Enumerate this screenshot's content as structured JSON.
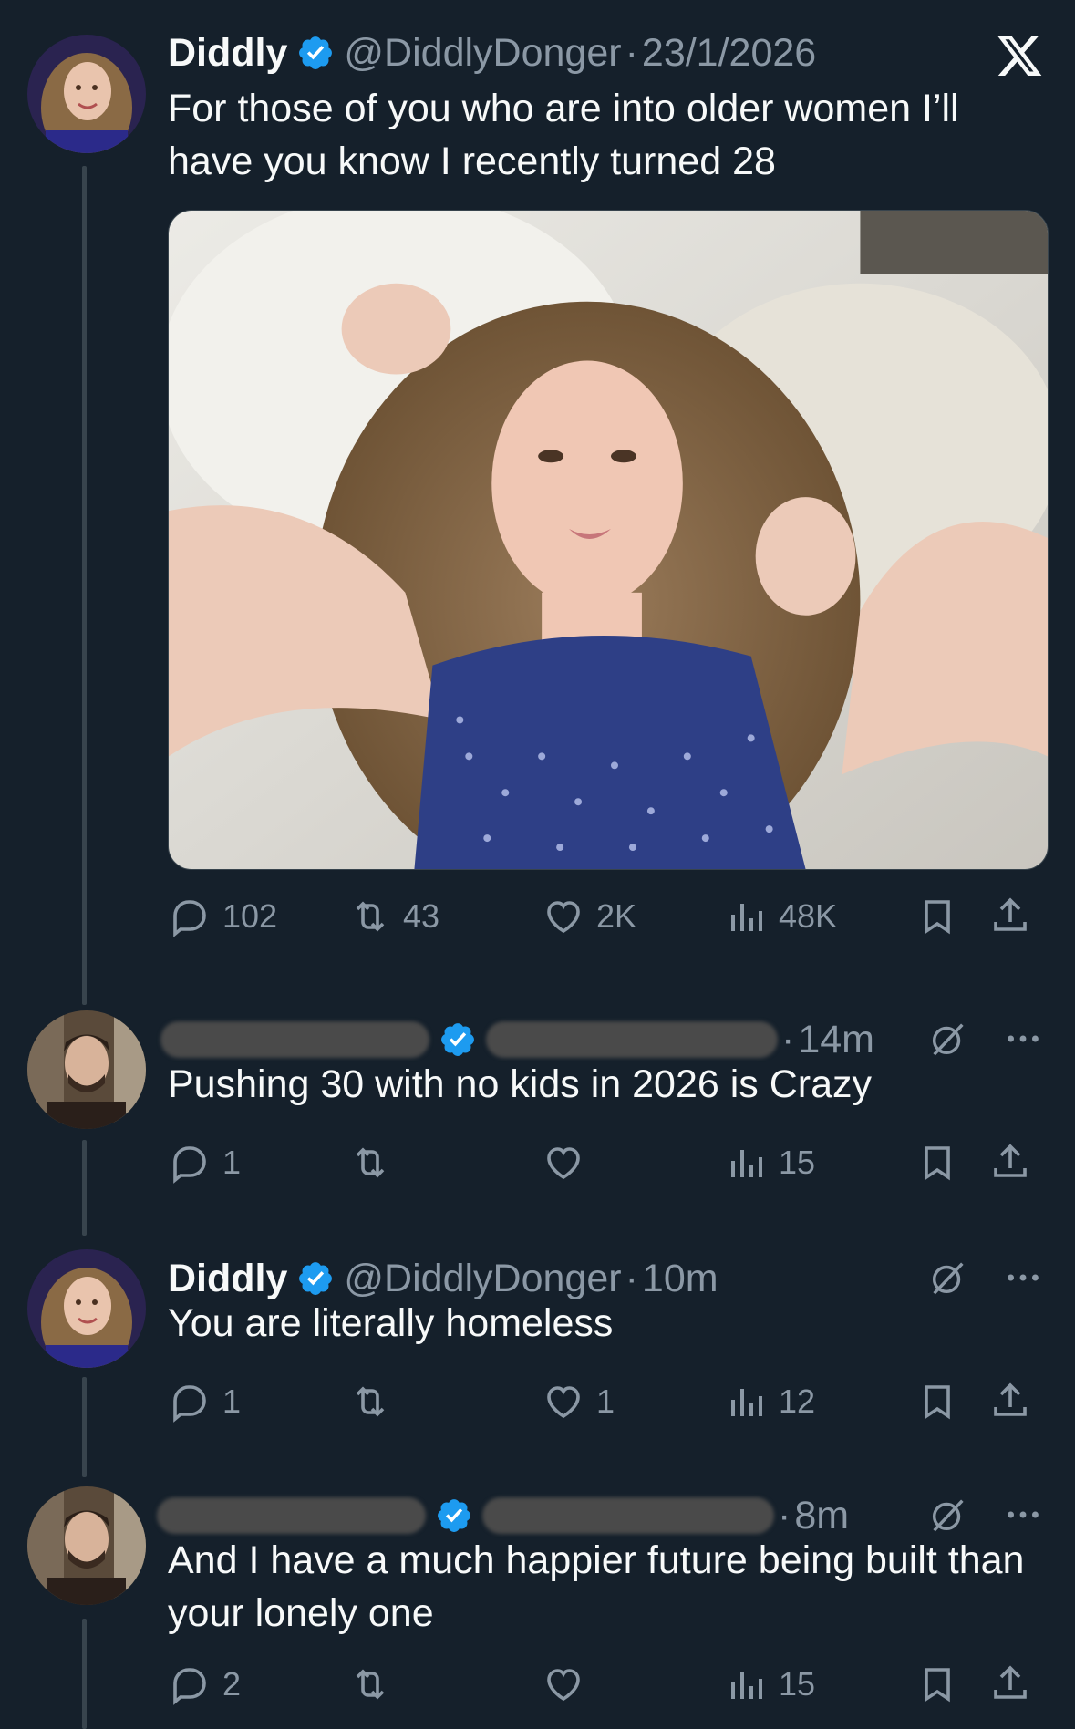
{
  "theme": {
    "background": "#15202b",
    "text": "#f7f9f9",
    "muted": "#8b98a5",
    "verified": "#1d9bf0",
    "line": "#38444d"
  },
  "tweets": [
    {
      "name": "Diddly",
      "handle": "@DiddlyDonger",
      "dot": "·",
      "time": "23/1/2026",
      "text": "For those of you who are into older women I’ll have you know I recently turned 28",
      "stats": {
        "replies": "102",
        "reposts": "43",
        "likes": "2K",
        "views": "48K"
      }
    },
    {
      "name": "",
      "handle": "",
      "dot": "·",
      "time": "14m",
      "text": "Pushing 30 with no kids in 2026 is Crazy",
      "stats": {
        "replies": "1",
        "reposts": "",
        "likes": "",
        "views": "15"
      }
    },
    {
      "name": "Diddly",
      "handle": "@DiddlyDonger",
      "dot": "·",
      "time": "10m",
      "text": "You are literally homeless",
      "stats": {
        "replies": "1",
        "reposts": "",
        "likes": "1",
        "views": "12"
      }
    },
    {
      "name": "",
      "handle": "",
      "dot": "·",
      "time": "8m",
      "text": "And I have a much happier future being built than your lonely one",
      "stats": {
        "replies": "2",
        "reposts": "",
        "likes": "",
        "views": "15"
      }
    }
  ],
  "icons": {
    "reply": "reply-icon",
    "repost": "repost-icon",
    "like": "heart-icon",
    "views": "views-icon",
    "bookmark": "bookmark-icon",
    "share": "share-icon",
    "grok": "grok-icon",
    "more": "more-icon",
    "x": "x-logo-icon",
    "verified": "verified-badge-icon"
  }
}
